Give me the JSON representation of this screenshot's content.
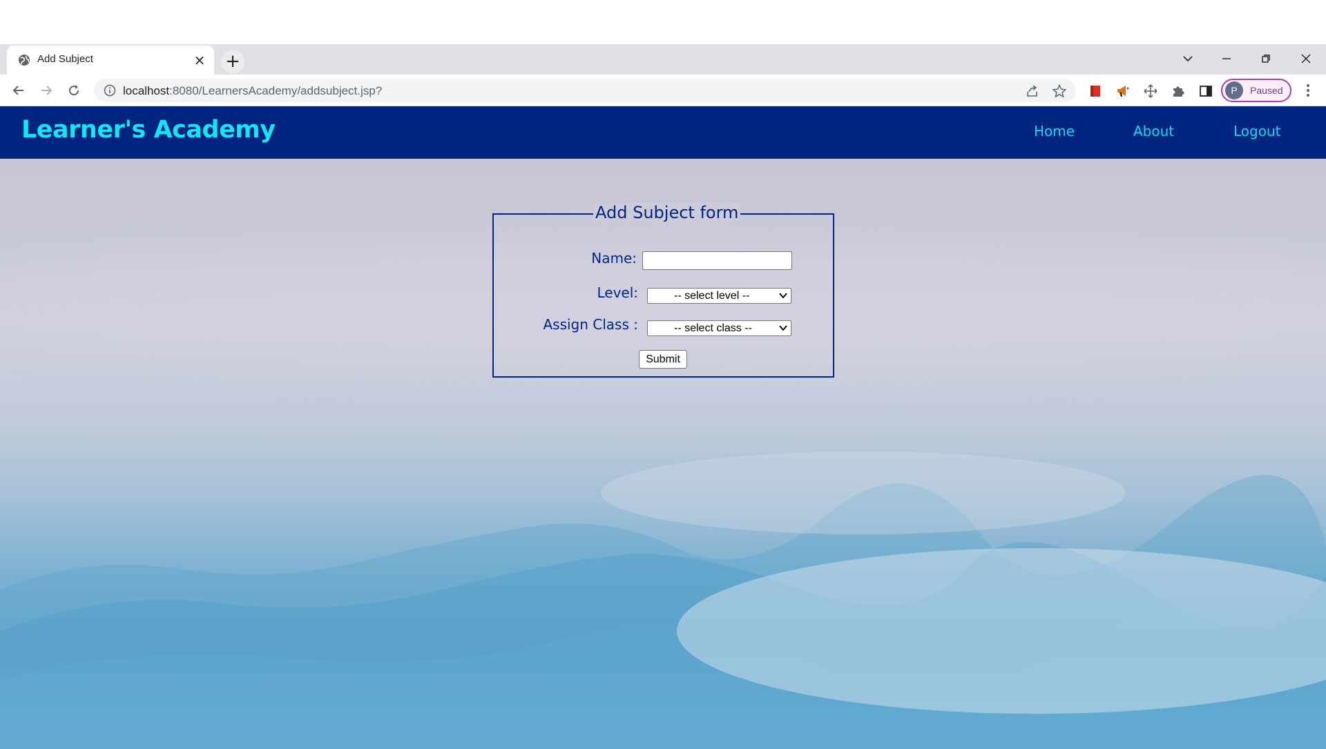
{
  "browser": {
    "tab": {
      "title": "Add Subject"
    },
    "new_tab_symbol": "+",
    "close_tab_symbol": "×",
    "address": {
      "host": "localhost",
      "path": ":8080/LearnersAcademy/addsubject.jsp?"
    },
    "profile": {
      "initial": "P",
      "status": "Paused"
    },
    "icons": {
      "favicon": "globe-icon",
      "back": "back-arrow-icon",
      "forward": "forward-arrow-icon",
      "reload": "reload-icon",
      "info": "info-icon",
      "share": "share-icon",
      "bookmark": "star-icon",
      "extensions": [
        "red-book-extension-icon",
        "megaphone-extension-icon",
        "move-extension-icon",
        "puzzle-icon",
        "side-panel-icon"
      ],
      "menu": "kebab-menu-icon",
      "tab_search": "chevron-down-icon",
      "minimize": "minimize-icon",
      "restore": "restore-icon",
      "close": "close-icon"
    }
  },
  "site": {
    "brand": "Learner's Academy",
    "nav": [
      {
        "label": "Home"
      },
      {
        "label": "About"
      },
      {
        "label": "Logout"
      }
    ],
    "colors": {
      "header_bg": "#012580",
      "brand": "#16e4f5",
      "nav_link": "#16d9f0",
      "form_text": "#012580"
    }
  },
  "form": {
    "legend": "Add Subject form",
    "name_label": "Name:",
    "name_value": "",
    "level_label": "Level:",
    "level_selected": "-- select level --",
    "class_label": "Assign Class :",
    "class_selected": "-- select class --",
    "submit_label": "Submit"
  }
}
